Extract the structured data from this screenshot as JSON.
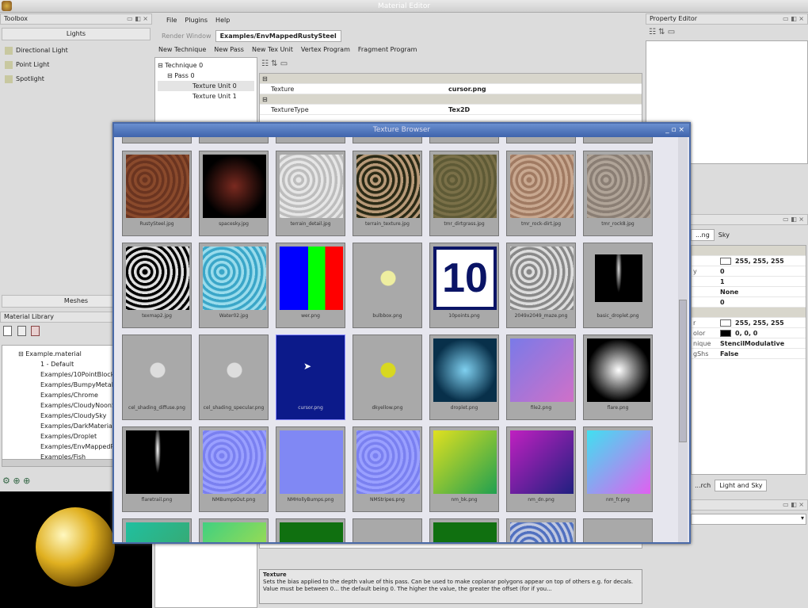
{
  "app": {
    "title": "Material Editor"
  },
  "toolbox": {
    "title": "Toolbox",
    "lights_label": "Lights",
    "items": [
      "Directional Light",
      "Point Light",
      "Spotlight"
    ],
    "meshes_label": "Meshes"
  },
  "material_library": {
    "title": "Material Library",
    "root": "Example.material",
    "items": [
      "1 - Default",
      "Examples/10PointBlock",
      "Examples/BumpyMetal",
      "Examples/Chrome",
      "Examples/CloudyNoonSkyBox",
      "Examples/CloudySky",
      "Examples/DarkMaterial",
      "Examples/Droplet",
      "Examples/EnvMappedRustySteel",
      "Examples/Fish"
    ]
  },
  "menu": [
    "File",
    "Plugins",
    "Help"
  ],
  "tabs": [
    {
      "label": "Render Window",
      "active": false
    },
    {
      "label": "Examples/EnvMappedRustySteel",
      "active": true
    }
  ],
  "toolbar": [
    "New Technique",
    "New Pass",
    "New Tex Unit",
    "Vertex Program",
    "Fragment Program"
  ],
  "technique_tree": {
    "technique": "Technique 0",
    "pass": "Pass 0",
    "units": [
      "Texture Unit 0",
      "Texture Unit 1"
    ]
  },
  "properties": [
    {
      "name": "Texture",
      "value": "cursor.png"
    },
    {
      "name": "TextureType",
      "value": "Tex2D"
    }
  ],
  "description": {
    "title": "Texture",
    "text": "Sets the bias applied to the depth value of this pass. Can be used to make coplanar polygons appear on top of others e.g. for decals. Value must be between 0... the default being 0. The higher the value, the greater the offset (for if you..."
  },
  "property_editor": {
    "title": "Property Editor"
  },
  "scene_panel": {
    "tabs": [
      "...ng",
      "Sky"
    ],
    "rows": [
      {
        "label": "",
        "value": "255, 255, 255",
        "swatch": "#ffffff"
      },
      {
        "label": "y",
        "value": "0"
      },
      {
        "label": "",
        "value": "1"
      },
      {
        "label": "",
        "value": "None"
      },
      {
        "label": "",
        "value": "0"
      },
      {
        "label": "r",
        "value": "255, 255, 255",
        "swatch": "#ffffff"
      },
      {
        "label": "olor",
        "value": "0, 0, 0",
        "swatch": "#000000"
      },
      {
        "label": "nique",
        "value": "StencilModulative"
      },
      {
        "label": "gShs",
        "value": "False"
      }
    ],
    "bottom_tabs": [
      "...rch",
      "Light and Sky"
    ]
  },
  "texture_browser": {
    "title": "Texture Browser",
    "textures": [
      {
        "name": "RustySteel.jpg",
        "kind": "noise",
        "colors": [
          "#6a3420",
          "#8a4a2c"
        ]
      },
      {
        "name": "spacesky.jpg",
        "kind": "radial",
        "colors": [
          "#7a2a20",
          "#000000"
        ]
      },
      {
        "name": "terrain_detail.jpg",
        "kind": "noise",
        "colors": [
          "#e6e6e6",
          "#bdbdbd"
        ]
      },
      {
        "name": "terrain_texture.jpg",
        "kind": "noise",
        "colors": [
          "#2a2a16",
          "#b89a78"
        ]
      },
      {
        "name": "tmr_dirtgrass.jpg",
        "kind": "noise",
        "colors": [
          "#7a7048",
          "#5e5a36"
        ]
      },
      {
        "name": "tmr_rock-dirt.jpg",
        "kind": "noise",
        "colors": [
          "#a07a62",
          "#c8a890"
        ]
      },
      {
        "name": "tmr_rock8.jpg",
        "kind": "noise",
        "colors": [
          "#b0a498",
          "#8a7e74"
        ]
      },
      {
        "name": "texmap2.jpg",
        "kind": "noise",
        "colors": [
          "#000000",
          "#e0e0e0"
        ]
      },
      {
        "name": "Water02.jpg",
        "kind": "noise",
        "colors": [
          "#3aa6c8",
          "#9adcec"
        ]
      },
      {
        "name": "wer.png",
        "kind": "bars",
        "colors": [
          "#0000ff",
          "#00ff00",
          "#ff0000"
        ]
      },
      {
        "name": "bulbbox.png",
        "kind": "dot",
        "colors": [
          "#a9a9a9",
          "#eeeea0"
        ]
      },
      {
        "name": "10points.png",
        "kind": "text",
        "text": "10",
        "colors": [
          "#ffffff",
          "#0a1466"
        ]
      },
      {
        "name": "2049x2049_maze.png",
        "kind": "noise",
        "colors": [
          "#888888",
          "#dddddd"
        ]
      },
      {
        "name": "basic_droplet.png",
        "kind": "streak",
        "colors": [
          "#000000",
          "#dddddd"
        ]
      },
      {
        "name": "cel_shading_diffuse.png",
        "kind": "dot",
        "colors": [
          "#a9a9a9",
          "#dddddd"
        ]
      },
      {
        "name": "cel_shading_specular.png",
        "kind": "dot",
        "colors": [
          "#a9a9a9",
          "#dddddd"
        ]
      },
      {
        "name": "cursor.png",
        "kind": "flat",
        "colors": [
          "#0c1a8a",
          "#0c1a8a"
        ]
      },
      {
        "name": "dkyellow.png",
        "kind": "dot",
        "colors": [
          "#a9a9a9",
          "#d8d820"
        ]
      },
      {
        "name": "droplet.png",
        "kind": "radial",
        "colors": [
          "#7fd0f0",
          "#08304a"
        ]
      },
      {
        "name": "file2.png",
        "kind": "linear",
        "colors": [
          "#7a7ae8",
          "#d070c8"
        ]
      },
      {
        "name": "flare.png",
        "kind": "radial",
        "colors": [
          "#ffffff",
          "#000000"
        ]
      },
      {
        "name": "flaretrail.png",
        "kind": "streak",
        "colors": [
          "#000000",
          "#ffffff"
        ]
      },
      {
        "name": "NMBumpsOut.png",
        "kind": "noise",
        "colors": [
          "#7a80f0",
          "#9aa0ff"
        ]
      },
      {
        "name": "NMHollyBumps.png",
        "kind": "flat",
        "colors": [
          "#8088f4",
          "#8088f4"
        ]
      },
      {
        "name": "NMStripes.png",
        "kind": "noise",
        "colors": [
          "#7a80f0",
          "#9aa0ff"
        ]
      },
      {
        "name": "nm_bk.png",
        "kind": "linear",
        "colors": [
          "#e0e020",
          "#20a050"
        ]
      },
      {
        "name": "nm_dn.png",
        "kind": "linear",
        "colors": [
          "#c020c0",
          "#202080"
        ]
      },
      {
        "name": "nm_fr.png",
        "kind": "linear",
        "colors": [
          "#40e0f0",
          "#e060f0"
        ]
      },
      {
        "name": "",
        "kind": "linear",
        "colors": [
          "#20c0a0",
          "#40a060"
        ]
      },
      {
        "name": "",
        "kind": "linear",
        "colors": [
          "#40d080",
          "#c0e040"
        ]
      },
      {
        "name": "",
        "kind": "flat",
        "colors": [
          "#107010",
          "#107010"
        ]
      },
      {
        "name": "",
        "kind": "flat",
        "colors": [
          "#a9a9a9",
          "#a9a9a9"
        ]
      },
      {
        "name": "",
        "kind": "flat",
        "colors": [
          "#107010",
          "#107010"
        ]
      },
      {
        "name": "",
        "kind": "noise",
        "colors": [
          "#c0c8e0",
          "#5070c0"
        ]
      },
      {
        "name": "",
        "kind": "flat",
        "colors": [
          "#a9a9a9",
          "#a9a9a9"
        ]
      }
    ]
  }
}
